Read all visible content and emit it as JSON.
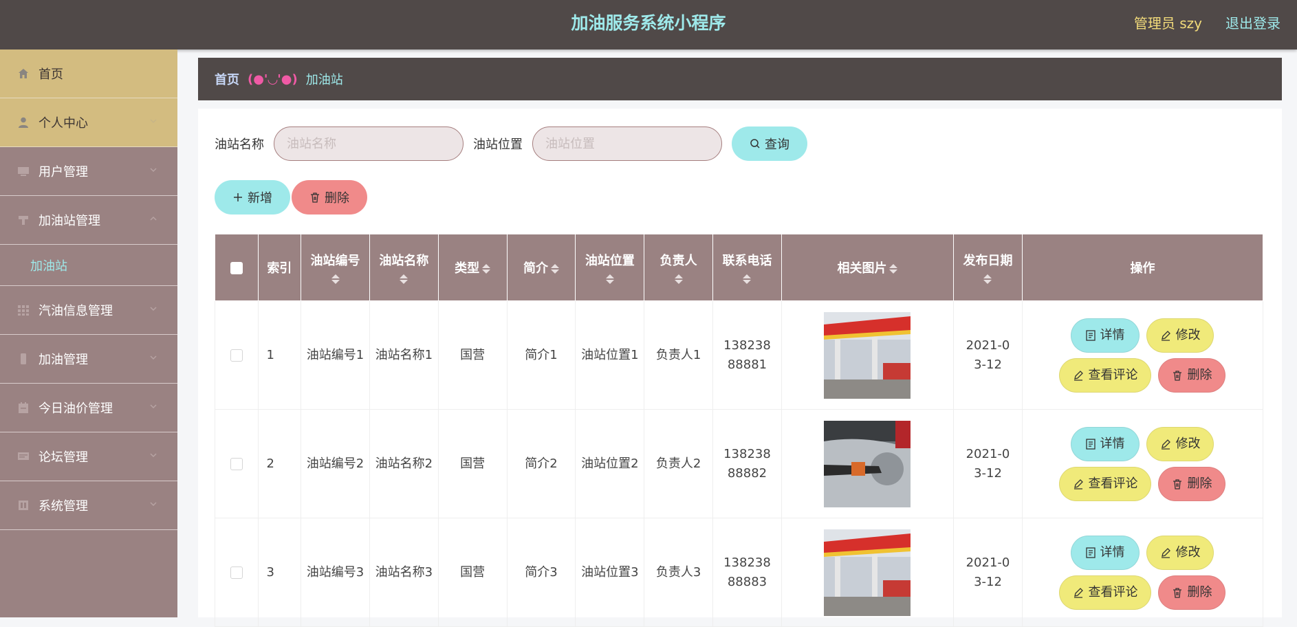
{
  "header": {
    "title": "加油服务系统小程序",
    "admin": "管理员 szy",
    "logout": "退出登录"
  },
  "sidebar": {
    "items": [
      {
        "label": "首页",
        "icon": "home-icon"
      },
      {
        "label": "个人中心",
        "icon": "user-icon"
      },
      {
        "label": "用户管理",
        "icon": "monitor-icon"
      },
      {
        "label": "加油站管理",
        "icon": "station-icon"
      },
      {
        "label": "汽油信息管理",
        "icon": "grid-icon"
      },
      {
        "label": "加油管理",
        "icon": "phone-icon"
      },
      {
        "label": "今日油价管理",
        "icon": "calendar-icon"
      },
      {
        "label": "论坛管理",
        "icon": "forum-icon"
      },
      {
        "label": "系统管理",
        "icon": "settings-icon"
      }
    ],
    "sub_item": "加油站"
  },
  "breadcrumb": {
    "home": "首页",
    "separator": "(●'◡'●)",
    "current": "加油站"
  },
  "search": {
    "name_label": "油站名称",
    "name_placeholder": "油站名称",
    "location_label": "油站位置",
    "location_placeholder": "油站位置",
    "query_button": "查询"
  },
  "actions": {
    "add_button": "新增",
    "delete_button": "删除"
  },
  "table": {
    "headers": {
      "index": "索引",
      "station_no": "油站编号",
      "station_name": "油站名称",
      "type": "类型",
      "intro": "简介",
      "location": "油站位置",
      "manager": "负责人",
      "phone": "联系电话",
      "image": "相关图片",
      "date": "发布日期",
      "ops": "操作"
    },
    "rows": [
      {
        "index": "1",
        "station_no": "油站编号1",
        "station_name": "油站名称1",
        "type": "国营",
        "intro": "简介1",
        "location": "油站位置1",
        "manager": "负责人1",
        "phone": "13823888881",
        "date": "2021-03-12"
      },
      {
        "index": "2",
        "station_no": "油站编号2",
        "station_name": "油站名称2",
        "type": "国营",
        "intro": "简介2",
        "location": "油站位置2",
        "manager": "负责人2",
        "phone": "13823888882",
        "date": "2021-03-12"
      },
      {
        "index": "3",
        "station_no": "油站编号3",
        "station_name": "油站名称3",
        "type": "国营",
        "intro": "简介3",
        "location": "油站位置3",
        "manager": "负责人3",
        "phone": "13823888883",
        "date": "2021-03-12"
      }
    ],
    "row_actions": {
      "detail": "详情",
      "edit": "修改",
      "comments": "查看评论",
      "delete": "删除"
    }
  },
  "colors": {
    "topbar": "#504948",
    "sidebar": "#9a8282",
    "active_menu": "#d3bc80",
    "accent_cyan": "#9ee9ea",
    "accent_yellow": "#f0ea7a",
    "danger": "#f08a8a"
  }
}
